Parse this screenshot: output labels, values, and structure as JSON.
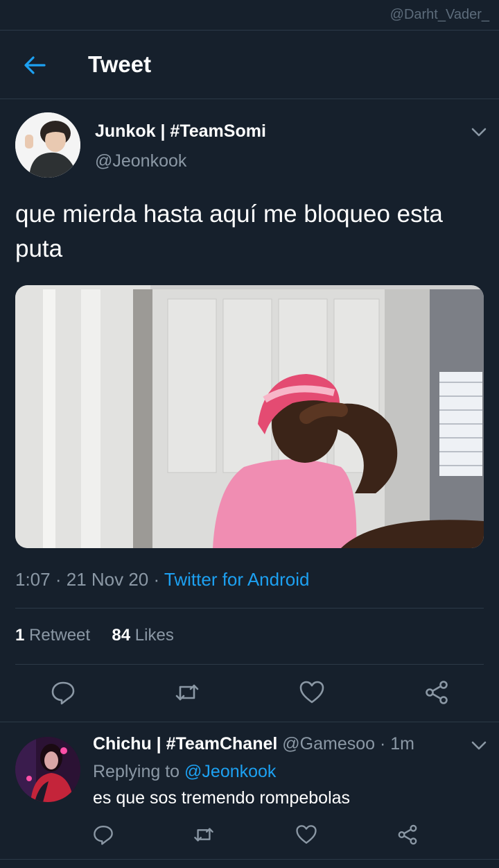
{
  "watermark": "@Darht_Vader_",
  "header": {
    "title": "Tweet"
  },
  "tweet": {
    "author_name": "Junkok | #TeamSomi",
    "author_handle": "@Jeonkook",
    "text": "que mierda hasta aquí me bloqueo esta puta",
    "time": "1:07",
    "date": "21 Nov 20",
    "source": "Twitter for Android",
    "retweets_count": "1",
    "retweets_label": "Retweet",
    "likes_count": "84",
    "likes_label": "Likes"
  },
  "reply": {
    "author_name": "Chichu | #TeamChanel",
    "author_handle": "@Gamesoo",
    "time_ago": "1m",
    "replying_label": "Replying to",
    "replying_handle": "@Jeonkook",
    "text": "es que sos tremendo rompebolas"
  },
  "colors": {
    "background": "#16202c",
    "accent": "#1da1f2",
    "muted": "#8b98a5",
    "divider": "#2c3a48"
  },
  "icons": [
    "back-arrow-icon",
    "chevron-down-icon",
    "reply-icon",
    "retweet-icon",
    "like-icon",
    "share-icon"
  ]
}
